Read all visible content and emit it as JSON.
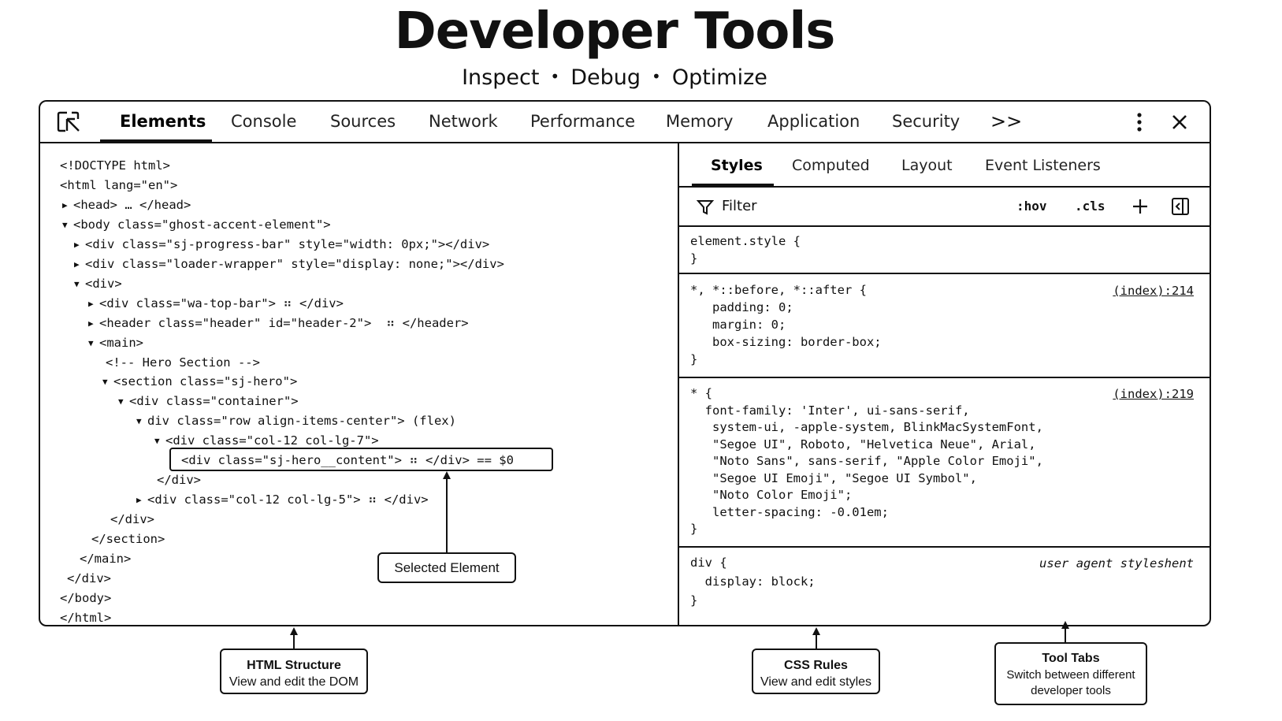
{
  "header": {
    "title": "Developer Tools",
    "subtitle_parts": [
      "Inspect",
      "Debug",
      "Optimize"
    ],
    "separator": "•"
  },
  "toolbar": {
    "tabs": [
      {
        "label": "Elements",
        "active": true
      },
      {
        "label": "Console"
      },
      {
        "label": "Sources"
      },
      {
        "label": "Network"
      },
      {
        "label": "Performance"
      },
      {
        "label": "Memory"
      },
      {
        "label": "Application"
      },
      {
        "label": "Security"
      }
    ],
    "more_label": ">>",
    "icons": [
      "inspect-element-icon",
      "more-options-icon",
      "close-icon"
    ]
  },
  "dom": {
    "lines": [
      {
        "indent": 0,
        "tri": "",
        "text": "<!DOCTYPE html>"
      },
      {
        "indent": 0,
        "tri": "",
        "text": "<html lang=\"en\">"
      },
      {
        "indent": 1,
        "tri": "▶",
        "text": "<head> … </head>"
      },
      {
        "indent": 1,
        "tri": "▼",
        "text": "<body class=\"ghost-accent-element\">"
      },
      {
        "indent": 2,
        "tri": "▶",
        "text": "<div class=\"sj-progress-bar\" style=\"width: 0px;\"></div>"
      },
      {
        "indent": 2,
        "tri": "▶",
        "text": "<div class=\"loader-wrapper\" style=\"display: none;\"></div>"
      },
      {
        "indent": 2,
        "tri": "▼",
        "text": "<div>"
      },
      {
        "indent": 3,
        "tri": "▶",
        "text": "<div class=\"wa-top-bar\"> ⠶ </div>"
      },
      {
        "indent": 3,
        "tri": "▶",
        "text": "<header class=\"header\" id=\"header-2\">  ⠶ </header>"
      },
      {
        "indent": 3,
        "tri": "▼",
        "text": "<main>"
      },
      {
        "indent": 4,
        "tri": "",
        "text": "<!-- Hero Section -->"
      },
      {
        "indent": 4,
        "tri": "▼",
        "text": "<section class=\"sj-hero\">"
      },
      {
        "indent": 5,
        "tri": "▼",
        "text": "<div class=\"container\">"
      },
      {
        "indent": 6,
        "tri": "▼",
        "text": "div class=\"row align-items-center\"> (flex)"
      },
      {
        "indent": 7,
        "tri": "▼",
        "text": "<div class=\"col-12 col-lg-7\">"
      },
      {
        "indent": 8,
        "tri": "",
        "text": "<div class=\"sj-hero__content\"> ⠶ </div> == $0"
      },
      {
        "indent": 7,
        "tri": "",
        "text": "</div>"
      },
      {
        "indent": 6,
        "tri": "▶",
        "text": "<div class=\"col-12 col-lg-5\"> ⠶ </div>"
      },
      {
        "indent": 5,
        "tri": "",
        "text": "</div>"
      },
      {
        "indent": 4,
        "tri": "",
        "text": "</section>"
      },
      {
        "indent": 3,
        "tri": "",
        "text": "</main>"
      },
      {
        "indent": 2,
        "tri": "",
        "text": "</div>"
      },
      {
        "indent": 1,
        "tri": "",
        "text": "</body>"
      },
      {
        "indent": 0,
        "tri": "",
        "text": "</html>"
      }
    ]
  },
  "styles": {
    "tabs": [
      {
        "label": "Styles",
        "active": true
      },
      {
        "label": "Computed"
      },
      {
        "label": "Layout"
      },
      {
        "label": "Event Listeners"
      }
    ],
    "filter_label": "Filter",
    "hov_label": ":hov",
    "cls_label": ".cls",
    "rules": [
      {
        "lines": [
          "element.style {",
          "}"
        ]
      },
      {
        "source": "(index):214",
        "lines": [
          "*, *::before, *::after {",
          "   padding: 0;",
          "   margin: 0;",
          "   box-sizing: border-box;",
          "}"
        ]
      },
      {
        "source": "(index):219",
        "lines": [
          "* {",
          "  font-family: 'Inter', ui-sans-serif,",
          "   system-ui, -apple-system, BlinkMacSystemFont,",
          "   \"Segoe UI\", Roboto, \"Helvetica Neue\", Arial,",
          "   \"Noto Sans\", sans-serif, \"Apple Color Emoji\",",
          "   \"Segoe UI Emoji\", \"Segoe UI Symbol\",",
          "   \"Noto Color Emoji\";",
          "   letter-spacing: -0.01em;",
          "}"
        ]
      },
      {
        "source": "user agent styleshent",
        "lines": [
          "div {",
          "  display: block;",
          "}"
        ]
      }
    ]
  },
  "callouts": {
    "selected": "Selected Element",
    "html_title": "HTML Structure",
    "html_sub": "View and edit the DOM",
    "css_title": "CSS Rules",
    "css_sub": "View and edit styles",
    "tools_title": "Tool Tabs",
    "tools_sub1": "Switch between different",
    "tools_sub2": "developer tools"
  }
}
